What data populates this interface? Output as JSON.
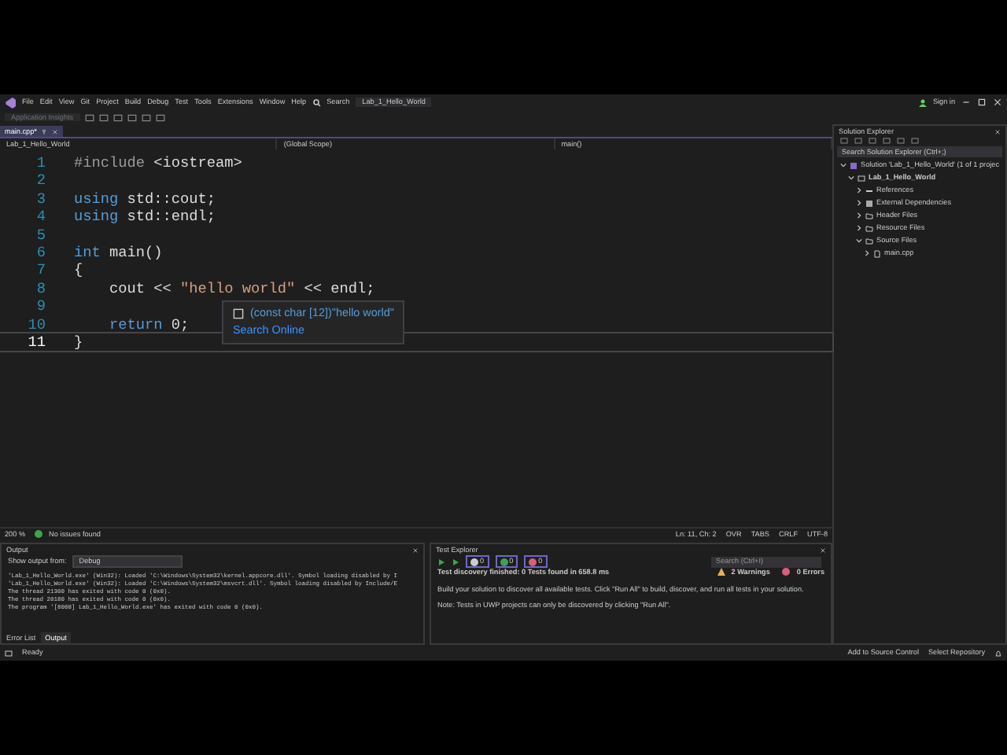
{
  "title_bar": {
    "menu": [
      "File",
      "Edit",
      "View",
      "Git",
      "Project",
      "Build",
      "Debug",
      "Test",
      "Tools",
      "Extensions",
      "Window",
      "Help"
    ],
    "search": "Search",
    "solution_name": "Lab_1_Hello_World",
    "sign_in": "Sign in"
  },
  "toolbar": {
    "insights": "Application Insights"
  },
  "document_tab": {
    "label": "main.cpp*",
    "selected": true
  },
  "navigation_bar": {
    "project": "Lab_1_Hello_World",
    "scope": "(Global Scope)",
    "member": "main()"
  },
  "editor": {
    "lines": [
      {
        "number": "1",
        "current": false,
        "tokens": [
          {
            "text": "#include ",
            "kind": "preprocessor"
          },
          {
            "text": "<iostream>",
            "kind": "plain"
          }
        ]
      },
      {
        "number": "2",
        "current": false
      },
      {
        "number": "3",
        "current": false,
        "tokens": [
          {
            "text": "using ",
            "kind": "keyword"
          },
          {
            "text": "std::cout;",
            "kind": "plain"
          }
        ]
      },
      {
        "number": "4",
        "current": false,
        "tokens": [
          {
            "text": "using ",
            "kind": "keyword"
          },
          {
            "text": "std::endl;",
            "kind": "plain"
          }
        ]
      },
      {
        "number": "5",
        "current": false
      },
      {
        "number": "6",
        "current": false,
        "tokens": [
          {
            "text": "int ",
            "kind": "keyword"
          },
          {
            "text": "main()",
            "kind": "plain"
          }
        ]
      },
      {
        "number": "7",
        "current": false,
        "tokens": [
          {
            "text": "{",
            "kind": "plain"
          }
        ]
      },
      {
        "number": "8",
        "current": false,
        "tokens": [
          {
            "text": "    cout << ",
            "kind": "plain"
          },
          {
            "text": "\"hello world\"",
            "kind": "string"
          },
          {
            "text": " << endl;",
            "kind": "plain"
          }
        ]
      },
      {
        "number": "9",
        "current": false
      },
      {
        "number": "10",
        "current": false,
        "tokens": [
          {
            "text": "    return ",
            "kind": "keyword"
          },
          {
            "text": "0;",
            "kind": "plain"
          }
        ]
      },
      {
        "number": "11",
        "current": true,
        "tokens": [
          {
            "text": "}",
            "kind": "plain"
          }
        ]
      }
    ],
    "tooltip": {
      "signature": "(const char [12])\"hello world\"",
      "link": "Search Online"
    }
  },
  "editor_status": {
    "zoom": "200 %",
    "issues": "No issues found",
    "position": "Ln: 11, Ch: 2",
    "items": [
      "OVR",
      "TABS",
      "CRLF",
      "UTF-8"
    ]
  },
  "solution_explorer": {
    "title": "Solution Explorer",
    "search": "Search Solution Explorer (Ctrl+;)",
    "tree": [
      {
        "label": "Solution 'Lab_1_Hello_World' (1 of 1 projec",
        "kind": "solution",
        "expanded": true,
        "children": [
          {
            "label": "Lab_1_Hello_World",
            "kind": "project",
            "expanded": true,
            "children": [
              {
                "label": "References",
                "kind": "references",
                "expanded": false
              },
              {
                "label": "External Dependencies",
                "kind": "dependencies",
                "expanded": false
              },
              {
                "label": "Header Files",
                "kind": "folder",
                "expanded": false
              },
              {
                "label": "Resource Files",
                "kind": "folder",
                "expanded": false
              },
              {
                "label": "Source Files",
                "kind": "folder",
                "expanded": true,
                "children": [
                  {
                    "label": "main.cpp",
                    "kind": "file",
                    "expanded": false
                  }
                ]
              }
            ]
          }
        ]
      }
    ]
  },
  "output": {
    "title": "Output",
    "show_from_label": "Show output from:",
    "source": "Debug",
    "lines": [
      "'Lab_1_Hello_World.exe' (Win32): Loaded 'C:\\Windows\\System32\\kernel.appcore.dll'. Symbol loading disabled by I",
      "'Lab_1_Hello_World.exe' (Win32): Loaded 'C:\\Windows\\System32\\msvcrt.dll'. Symbol loading disabled by Include/E",
      "The thread 21300 has exited with code 0 (0x0).",
      "The thread 20180 has exited with code 0 (0x0).",
      "The program '[8008] Lab_1_Hello_World.exe' has exited with code 0 (0x0)."
    ],
    "tabs": [
      {
        "label": "Error List",
        "selected": false
      },
      {
        "label": "Output",
        "selected": true
      }
    ]
  },
  "test_explorer": {
    "title": "Test Explorer",
    "counts": [
      {
        "value": "0",
        "kind": "total"
      },
      {
        "value": "0",
        "kind": "passed"
      },
      {
        "value": "0",
        "kind": "failed"
      }
    ],
    "search": "Search (Ctrl+I)",
    "summary": "Test discovery finished: 0 Tests found in 658.8 ms",
    "warnings": "2 Warnings",
    "errors": "0 Errors",
    "messages": [
      "Build your solution to discover all available tests. Click \"Run All\" to build, discover, and run all tests in your solution.",
      "Note: Tests in UWP projects can only be discovered by clicking \"Run All\"."
    ]
  },
  "status_bar": {
    "state": "Ready",
    "source_control": "Add to Source Control",
    "repository": "Select Repository"
  }
}
